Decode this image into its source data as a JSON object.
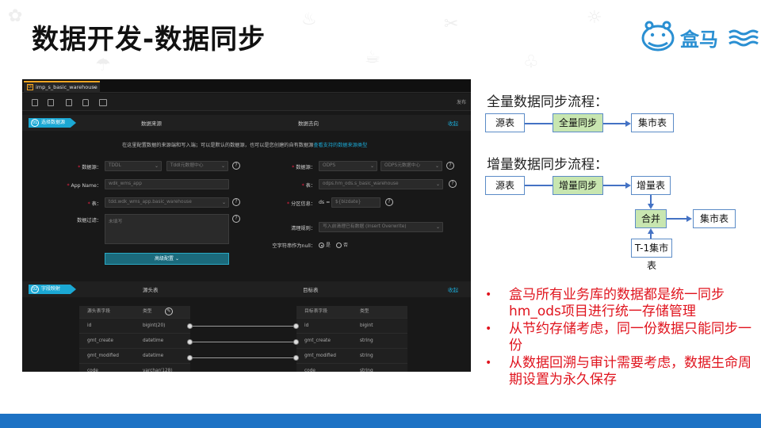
{
  "slide": {
    "title": "数据开发-数据同步",
    "logo_text": "盒马"
  },
  "screenshot": {
    "tab_label": "imp_s_basic_warehouse",
    "tab_icon": "DI",
    "toolbar": {
      "publish_label": "发布"
    },
    "section1": {
      "step_number": "01",
      "step_label": "选择数据源",
      "source_col": "数据来源",
      "target_col": "数据去向",
      "collapse": "收起"
    },
    "intro_text": "在这里配置数据的来源端和写入端；可以是默认的数据源，也可以是您创建的自有数据源",
    "intro_link": "查看支持的数据来源类型",
    "source": {
      "datasource_label": "数据源：",
      "datasource_value": "TDDL",
      "datasource_value2": "TddI元数据中心",
      "appname_label": "App Name：",
      "appname_value": "wdk_wms_app",
      "table_label": "表：",
      "table_value": "tdd.wdk_wms_app.basic_warehouse",
      "filter_label": "数据过滤：",
      "filter_placeholder": "未填写",
      "advanced_btn": "高级配置"
    },
    "target": {
      "datasource_label": "数据源：",
      "datasource_value": "ODPS",
      "datasource_value2": "ODPS元数据中心",
      "table_label": "表：",
      "table_value": "odps.hm_ods.s_basic_warehouse",
      "partition_label": "分区信息：",
      "partition_key": "ds =",
      "partition_value": "${bizdate}",
      "clean_label": "清理规则：",
      "clean_value": "写入前清理已有数据 (Insert Overwrite)",
      "null_label": "空字符串作为null：",
      "radio_yes": "是",
      "radio_no": "否"
    },
    "section2": {
      "step_number": "02",
      "step_label": "字段映射",
      "source_col": "源头表",
      "target_col": "目标表",
      "collapse": "收起"
    },
    "mapping": {
      "src_headers": [
        "源头表字段",
        "类型"
      ],
      "dst_headers": [
        "目标表字段",
        "类型"
      ],
      "src_rows": [
        [
          "id",
          "bigint(20)"
        ],
        [
          "gmt_create",
          "datetime"
        ],
        [
          "gmt_modified",
          "datetime"
        ],
        [
          "code",
          "varchar(128)"
        ]
      ],
      "dst_rows": [
        [
          "id",
          "bigint"
        ],
        [
          "gmt_create",
          "string"
        ],
        [
          "gmt_modified",
          "string"
        ],
        [
          "code",
          "string"
        ]
      ]
    }
  },
  "full_sync": {
    "title": "全量数据同步流程：",
    "source": "源表",
    "process": "全量同步",
    "target": "集市表"
  },
  "incremental_sync": {
    "title": "增量数据同步流程：",
    "source": "源表",
    "process": "增量同步",
    "incr_table": "增量表",
    "merge": "合并",
    "target": "集市表",
    "prev_table": "T-1集市表"
  },
  "bullets": [
    "盒马所有业务库的数据都是统一同步hm_ods项目进行统一存储管理",
    "从节约存储考虑，同一份数据只能同步一份",
    "从数据回溯与审计需要考虑，数据生命周期设置为永久保存"
  ],
  "colors": {
    "accent_blue": "#1d72c4",
    "bullet_red": "#e0141e",
    "node_green": "#c8e6b0",
    "ide_teal": "#1ba8d4"
  }
}
